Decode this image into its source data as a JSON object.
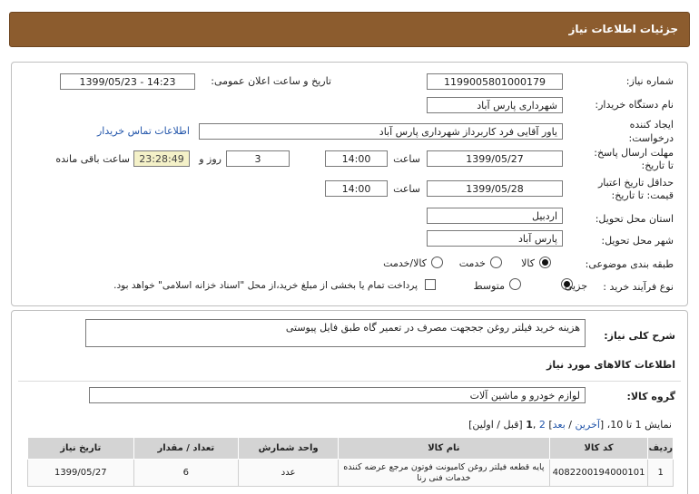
{
  "header": {
    "title": "جزئیات اطلاعات نیاز"
  },
  "form": {
    "need_number_label": "شماره نیاز:",
    "need_number": "1199005801000179",
    "announce_label": "تاریخ و ساعت اعلان عمومی:",
    "announce_value": "1399/05/23 - 14:23",
    "buyer_label": "نام دستگاه خریدار:",
    "buyer_value": "شهرداری پارس آباد",
    "creator_label": "ایجاد کننده درخواست:",
    "creator_value": "یاور آقایی فرد کاربرداز شهرداری پارس آباد",
    "contact_link": "اطلاعات تماس خریدار",
    "send_deadline_label": "مهلت ارسال پاسخ: تا تاریخ:",
    "send_deadline_date": "1399/05/27",
    "time_label": "ساعت",
    "send_deadline_time": "14:00",
    "days_value": "3",
    "days_label": "روز و",
    "remaining_time": "23:28:49",
    "remaining_label": "ساعت باقی مانده",
    "validity_label": "حداقل تاریخ اعتبار قیمت: تا تاریخ:",
    "validity_date": "1399/05/28",
    "validity_time": "14:00",
    "province_label": "استان محل تحویل:",
    "province_value": "اردبیل",
    "city_label": "شهر محل تحویل:",
    "city_value": "پارس آباد",
    "category_label": "طبقه بندی موضوعی:",
    "category_options": [
      "کالا",
      "خدمت",
      "کالا/خدمت"
    ],
    "category_selected": "کالا",
    "process_label": "نوع فرآیند خرید :",
    "process_options": [
      "جزیی",
      "متوسط"
    ],
    "process_selected": "جزیی",
    "payment_note": "پرداخت تمام یا بخشی از مبلغ خرید،از محل \"اسناد خزانه اسلامی\" خواهد بود."
  },
  "details": {
    "description_label": "شرح کلی نیاز:",
    "description_value": "هزینه  خرید فیلتر روغن جججهت مصرف در تعمیر گاه طبق فایل پیوستی",
    "goods_info_title": "اطلاعات کالاهای مورد نیاز",
    "goods_group_label": "گروه کالا:",
    "goods_group_value": "لوازم خودرو و ماشین آلات",
    "pagination": {
      "prefix": "نمایش 1 تا 10، [",
      "last": "آخرین",
      "sep1": " / ",
      "next": "بعد",
      "mid": "] ",
      "page2": "2",
      "comma": " ,",
      "page1": "1",
      "suffix": " [قبل / اولین]"
    }
  },
  "table": {
    "columns": [
      "ردیف",
      "کد کالا",
      "نام کالا",
      "واحد شمارش",
      "تعداد / مقدار",
      "تاریخ نیاز"
    ],
    "rows": [
      [
        "1",
        "4082200194000101",
        "پایه قطعه فیلتر روغن کامیونت فوتون مرجع عرضه کننده خدمات فنی رنا",
        "عدد",
        "6",
        "1399/05/27"
      ]
    ]
  },
  "colors": {
    "header_bg": "#8c5c2e",
    "table_header_bg": "#d4d4d4",
    "link": "#2255aa",
    "timer_bg": "#f4f1c8"
  }
}
